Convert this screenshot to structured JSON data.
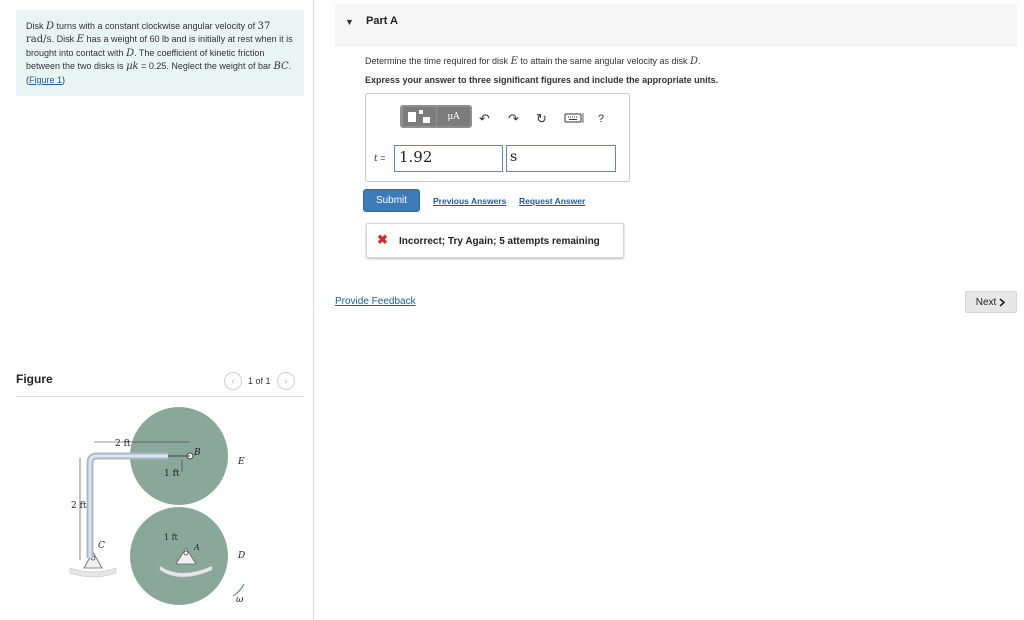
{
  "problem": {
    "t1": "Disk ",
    "m1": "D",
    "t2": " turns with a constant clockwise angular velocity of ",
    "num": "37",
    "unit": " rad/s",
    "t3": ". Disk ",
    "m2": "E",
    "t4": " has a weight of 60 lb and is initially at rest when it is brought into contact with ",
    "m3": "D",
    "t5": ". The coefficient of kinetic friction between the two disks is ",
    "mu": "μk",
    "t6": " = 0.25. Neglect the weight of bar ",
    "m4": "BC",
    "t7": ". (",
    "fig_link": "Figure 1",
    "t8": ")"
  },
  "figure_panel": {
    "title": "Figure",
    "pager": "1 of 1",
    "prev_icon": "chevron-left",
    "next_icon": "chevron-right"
  },
  "figure_labels": {
    "dim_top": "2 ft",
    "dim_left": "2 ft",
    "dim_mid": "1 ft",
    "dim_low": "1 ft",
    "B": "B",
    "E": "E",
    "C": "C",
    "A": "A",
    "D": "D",
    "omega": "ω"
  },
  "part": {
    "caret": "▼",
    "title": "Part A"
  },
  "question": {
    "q1": "Determine the time required for disk ",
    "m1": "E",
    "q2": " to attain the same angular velocity as disk ",
    "m2": "D",
    "q3": ".",
    "instruction": "Express your answer to three significant figures and include the appropriate units."
  },
  "toolbar": {
    "units_label": "μA",
    "help": "?"
  },
  "answer": {
    "variable": "t",
    "equals": " =",
    "value": "1.92",
    "unit": "s"
  },
  "actions": {
    "submit": "Submit",
    "previous": "Previous Answers",
    "request": "Request Answer"
  },
  "feedback": {
    "icon": "✖",
    "message": "Incorrect; Try Again; 5 attempts remaining"
  },
  "footer": {
    "provide_feedback": "Provide Feedback",
    "next": "Next"
  },
  "colors": {
    "accent": "#3c7ab8",
    "link": "#1a5fa8",
    "error": "#d0312d",
    "problem_bg": "#e9f5f5",
    "disk": "#8aa89a"
  }
}
